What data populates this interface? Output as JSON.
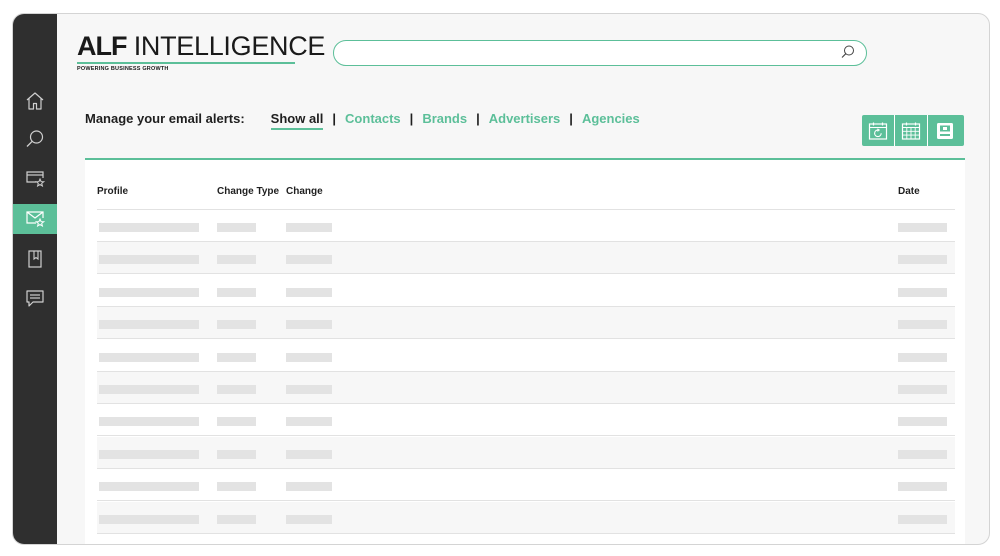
{
  "brand": {
    "name_bold": "ALF",
    "name_rest": "INTELLIGENCE",
    "tagline": "POWERING BUSINESS GROWTH",
    "accent_color": "#5cbf99",
    "sidebar_color": "#2f2f2f"
  },
  "sidebar": {
    "items": [
      {
        "icon": "home-icon",
        "active": false
      },
      {
        "icon": "search-icon",
        "active": false
      },
      {
        "icon": "saved-search-icon",
        "active": false
      },
      {
        "icon": "email-alerts-icon",
        "active": true
      },
      {
        "icon": "bookmark-icon",
        "active": false
      },
      {
        "icon": "chat-icon",
        "active": false
      }
    ]
  },
  "search": {
    "value": "",
    "placeholder": ""
  },
  "alerts": {
    "label": "Manage your email alerts:",
    "filters": [
      "Show all",
      "Contacts",
      "Brands",
      "Advertisers",
      "Agencies"
    ],
    "active_filter": "Show all"
  },
  "toolbar": {
    "buttons": [
      "refresh-calendar-icon",
      "calendar-grid-icon",
      "save-icon"
    ]
  },
  "table": {
    "columns": [
      "Profile",
      "Change Type",
      "Change",
      "Date"
    ],
    "placeholder_rows": 10
  }
}
